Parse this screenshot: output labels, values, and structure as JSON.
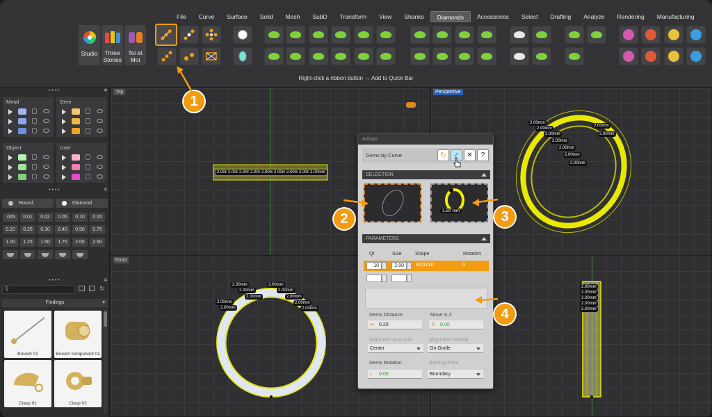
{
  "menu": {
    "tabs": [
      "File",
      "Curve",
      "Surface",
      "Solid",
      "Mesh",
      "SubD",
      "Transform",
      "View",
      "Shanks",
      "Diamonds",
      "Accessories",
      "Select",
      "Drafting",
      "Analyze",
      "Rendering",
      "Manufacturing"
    ],
    "active": "Diamonds"
  },
  "ribbon": {
    "big_buttons": [
      {
        "label": "Studio"
      },
      {
        "label": "Three Stones"
      },
      {
        "label": "Toi et Moi"
      }
    ],
    "quickbar_hint": "Right-click a ribbon button → Add to Quick Bar"
  },
  "layers": {
    "metal": {
      "title": "Metal",
      "colors": [
        "#9fb7f0",
        "#8aa6ea",
        "#6e8fe0"
      ]
    },
    "gem": {
      "title": "Gem",
      "colors": [
        "#f3c76a",
        "#f0b945",
        "#eea628"
      ]
    },
    "object": {
      "title": "Object",
      "colors": [
        "#b7f0b2",
        "#9fe39a",
        "#7fd07a"
      ]
    },
    "user": {
      "title": "User",
      "colors": [
        "#f7b3c6",
        "#f27fb0",
        "#e64ac8"
      ]
    }
  },
  "gem_selector": {
    "cut": "Round",
    "type": "Diamond"
  },
  "sizes": [
    ".005",
    "0.01",
    "0.02",
    "0.05",
    "0.10",
    "0.15",
    "0.20",
    "0.25",
    "0.30",
    "0.40",
    "0.50",
    "0.75",
    "1.00",
    "1.25",
    "1.50",
    "1.75",
    "2.00",
    "2.50"
  ],
  "findings": {
    "title": "Findings",
    "items": [
      {
        "label": "Brooch 01"
      },
      {
        "label": "Brooch component 01"
      },
      {
        "label": "Clasp 01"
      },
      {
        "label": "Clasp 02"
      }
    ]
  },
  "viewports": {
    "top": "Top",
    "perspective": "Perspective",
    "front": "Front"
  },
  "artisan": {
    "title": "Artisan",
    "tool": "Gems by Curve",
    "selection_header": "SELECTION",
    "selection_gem_label": "1.50 mm",
    "parameters_header": "PARAMETERS",
    "columns": {
      "qt": "Qt",
      "size": "Size",
      "shape": "Shape",
      "rotation": "Rotation"
    },
    "row": {
      "qt": "10",
      "size": "2.00",
      "shape": "ROUND",
      "rotation": "0"
    },
    "gems_distance_label": "Gems Distance",
    "gems_distance": "0.20",
    "move_z_label": "Move in Z",
    "move_z": "0.00",
    "align_curve_label": "Alignment on Curve",
    "align_curve": "Center",
    "align_vertical_label": "Alignment Vertical",
    "align_vertical": "On Girdle",
    "gems_rotation_label": "Gems Rotation",
    "gems_rotation": "0.00",
    "start_point_label": "Starting Point",
    "start_point": "Boundary"
  },
  "callouts": [
    "1",
    "2",
    "3",
    "4"
  ],
  "gem_label": "2.00mm",
  "accent": "#f39c12"
}
